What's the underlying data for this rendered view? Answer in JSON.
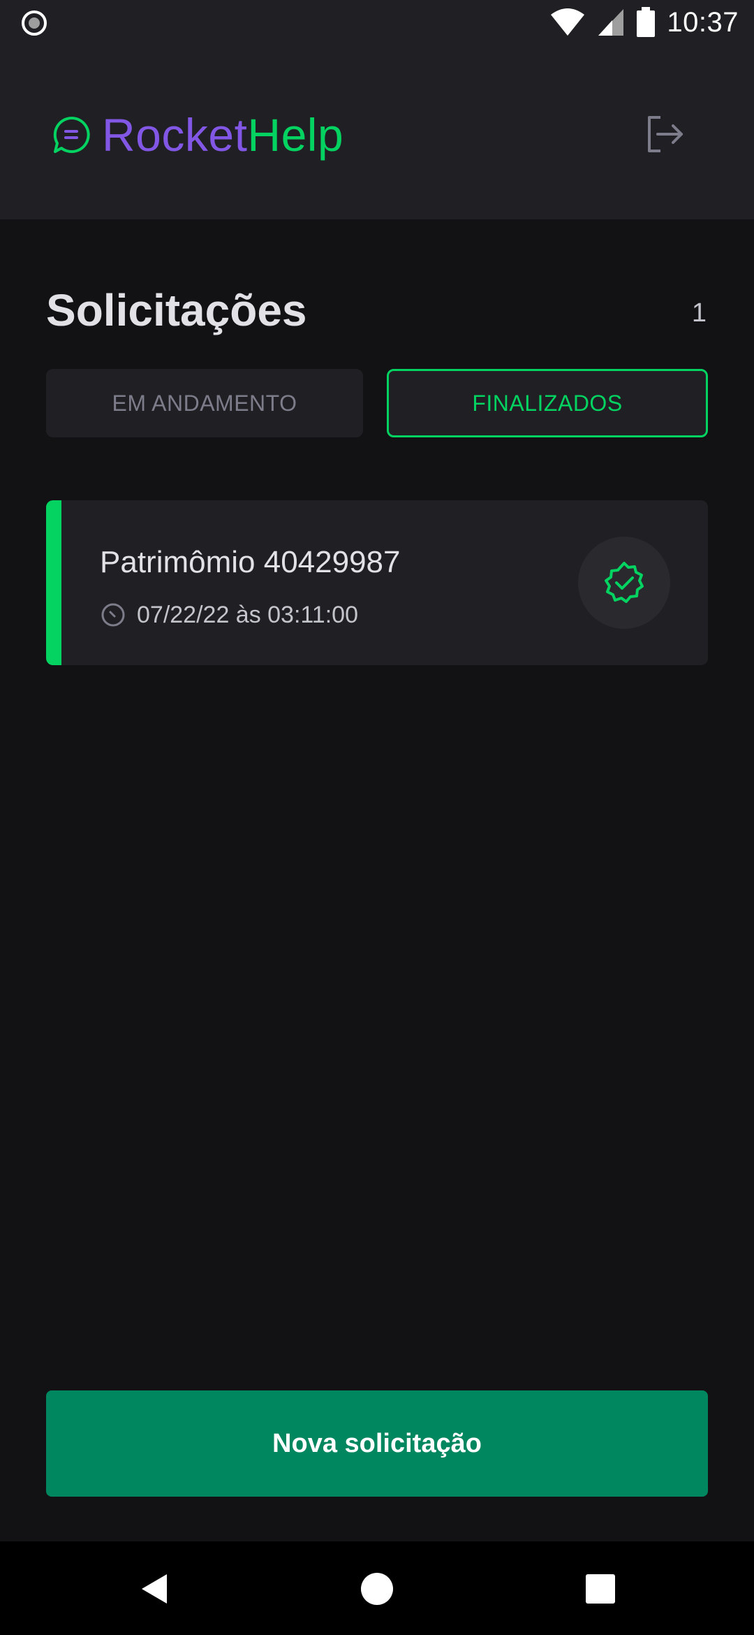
{
  "status_bar": {
    "time": "10:37",
    "icons": [
      "record-icon",
      "wifi-icon",
      "cellular-signal-icon",
      "battery-icon"
    ]
  },
  "header": {
    "logo": {
      "part1": "Rocket",
      "part2": "Help",
      "icon": "chat-bubble-icon"
    },
    "logout_icon": "logout-icon"
  },
  "main": {
    "title": "Solicitações",
    "count": "1",
    "tabs": [
      {
        "label": "EM ANDAMENTO",
        "active": false
      },
      {
        "label": "FINALIZADOS",
        "active": true
      }
    ],
    "orders": [
      {
        "title": "Patrimômio 40429987",
        "date": "07/22/22 às 03:11:00",
        "status_icon": "circle-check-icon",
        "status": "closed"
      }
    ]
  },
  "footer": {
    "new_request_label": "Nova solicitação"
  },
  "navigation_bar": {
    "buttons": [
      "back-icon",
      "home-icon",
      "recents-icon"
    ]
  },
  "colors": {
    "background": "#121214",
    "surface": "#202024",
    "purple": "#8257E5",
    "green_accent": "#04D361",
    "green_button": "#00875F",
    "text_primary": "#E1E1E6",
    "text_muted": "#7C7C8A"
  }
}
